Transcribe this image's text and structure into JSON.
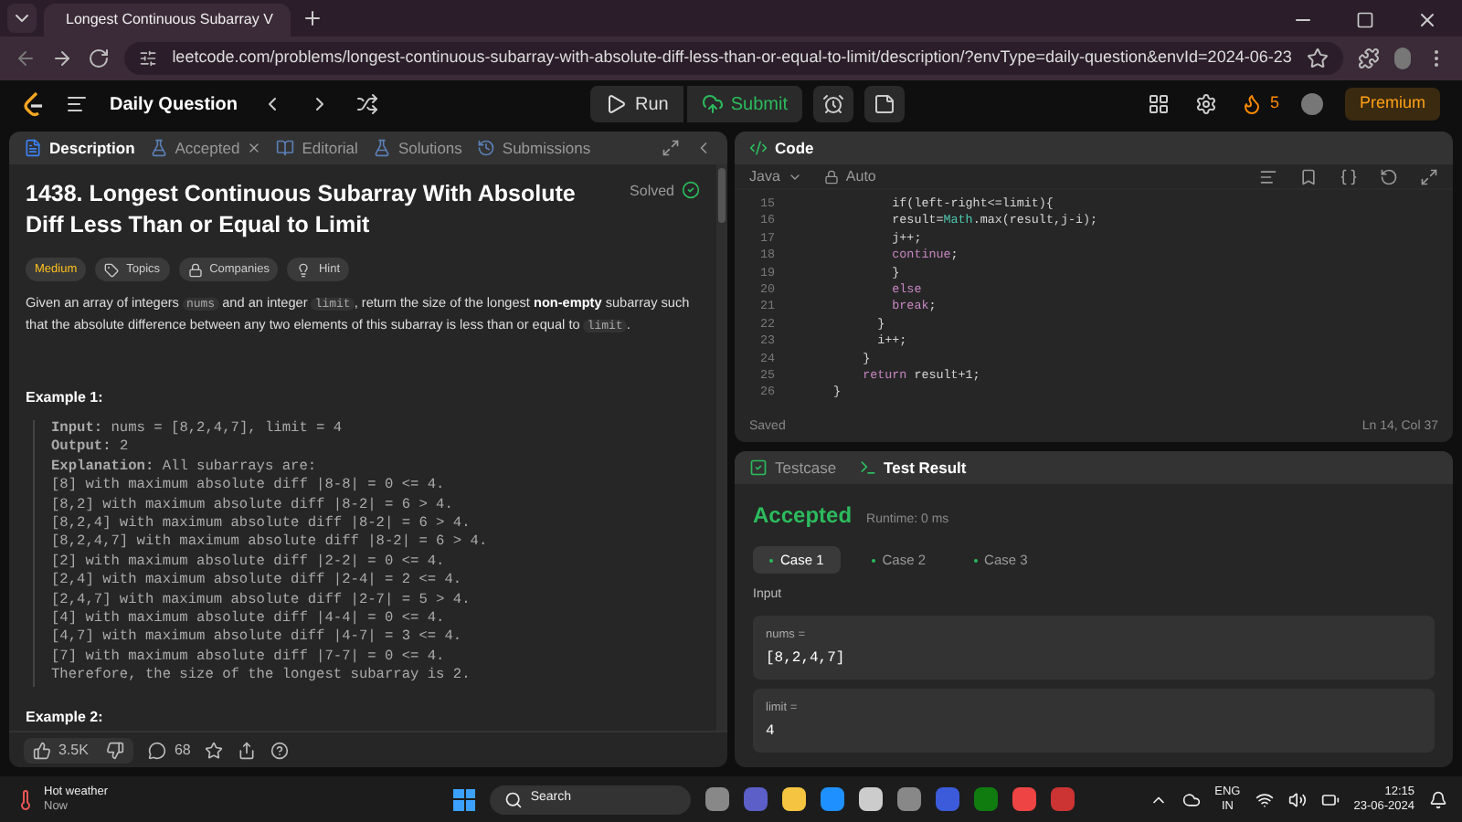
{
  "browser": {
    "tab_title": "Longest Continuous Subarray V",
    "url": "leetcode.com/problems/longest-continuous-subarray-with-absolute-diff-less-than-or-equal-to-limit/description/?envType=daily-question&envId=2024-06-23"
  },
  "nav": {
    "title": "Daily Question",
    "run": "Run",
    "submit": "Submit",
    "streak": "5",
    "premium": "Premium"
  },
  "left_tabs": [
    {
      "label": "Description",
      "selected": true
    },
    {
      "label": "Accepted",
      "selected": false,
      "closable": true
    },
    {
      "label": "Editorial",
      "selected": false
    },
    {
      "label": "Solutions",
      "selected": false
    },
    {
      "label": "Submissions",
      "selected": false
    }
  ],
  "problem": {
    "title": "1438. Longest Continuous Subarray With Absolute Diff Less Than or Equal to Limit",
    "status": "Solved",
    "tags": [
      {
        "label": "Medium",
        "kind": "difficulty"
      },
      {
        "label": "Topics",
        "kind": "topics"
      },
      {
        "label": "Companies",
        "kind": "companies"
      },
      {
        "label": "Hint",
        "kind": "hint"
      }
    ],
    "description": [
      {
        "text": "Given an array of integers ",
        "kind": "plain"
      },
      {
        "text": "nums",
        "kind": "code"
      },
      {
        "text": " and an integer ",
        "kind": "plain"
      },
      {
        "text": "limit",
        "kind": "code"
      },
      {
        "text": ", return the size of the longest ",
        "kind": "plain"
      },
      {
        "text": "non-empty",
        "kind": "bold"
      },
      {
        "text": " subarray such that the absolute difference between any two elements of this subarray is less than or equal to ",
        "kind": "plain"
      },
      {
        "text": "limit",
        "kind": "code"
      },
      {
        "text": ".",
        "kind": "plain"
      }
    ],
    "example_1_heading": "Example 1:",
    "example_1": [
      "**Input:** nums = [8,2,4,7], limit = 4",
      "**Output:** 2",
      "**Explanation:** All subarrays are:",
      "[8] with maximum absolute diff |8-8| = 0 <= 4.",
      "[8,2] with maximum absolute diff |8-2| = 6 > 4.",
      "[8,2,4] with maximum absolute diff |8-2| = 6 > 4.",
      "[8,2,4,7] with maximum absolute diff |8-2| = 6 > 4.",
      "[2] with maximum absolute diff |2-2| = 0 <= 4.",
      "[2,4] with maximum absolute diff |2-4| = 2 <= 4.",
      "[2,4,7] with maximum absolute diff |2-7| = 5 > 4.",
      "[4] with maximum absolute diff |4-4| = 0 <= 4.",
      "[4,7] with maximum absolute diff |4-7| = 3 <= 4.",
      "[7] with maximum absolute diff |7-7| = 0 <= 4.",
      "Therefore, the size of the longest subarray is 2."
    ],
    "example_2_heading": "Example 2:"
  },
  "footer": {
    "likes": "3.5K",
    "comments": "68"
  },
  "code": {
    "title": "Code",
    "language": "Java",
    "mode": "Auto",
    "lines": [
      {
        "number": "15",
        "tokens": [
          {
            "text": "            if(left-right<=limit){",
            "kind": "plain"
          }
        ]
      },
      {
        "number": "16",
        "tokens": [
          {
            "text": "            result=",
            "kind": "plain"
          },
          {
            "text": "Math",
            "kind": "class"
          },
          {
            "text": ".max(result,j-i);",
            "kind": "plain"
          }
        ]
      },
      {
        "number": "17",
        "tokens": [
          {
            "text": "            j++;",
            "kind": "plain"
          }
        ]
      },
      {
        "number": "18",
        "tokens": [
          {
            "text": "            continue",
            "kind": "keyword"
          },
          {
            "text": ";",
            "kind": "plain"
          }
        ]
      },
      {
        "number": "19",
        "tokens": [
          {
            "text": "            }",
            "kind": "plain"
          }
        ]
      },
      {
        "number": "20",
        "tokens": [
          {
            "text": "            else",
            "kind": "keyword"
          }
        ]
      },
      {
        "number": "21",
        "tokens": [
          {
            "text": "            break",
            "kind": "keyword"
          },
          {
            "text": ";",
            "kind": "plain"
          }
        ]
      },
      {
        "number": "22",
        "tokens": [
          {
            "text": "          }",
            "kind": "plain"
          }
        ]
      },
      {
        "number": "23",
        "tokens": [
          {
            "text": "          i++;",
            "kind": "plain"
          }
        ]
      },
      {
        "number": "24",
        "tokens": [
          {
            "text": "        }",
            "kind": "plain"
          }
        ]
      },
      {
        "number": "25",
        "tokens": [
          {
            "text": "        return",
            "kind": "keyword"
          },
          {
            "text": " result+1;",
            "kind": "plain"
          }
        ]
      },
      {
        "number": "26",
        "tokens": [
          {
            "text": "    }",
            "kind": "plain"
          }
        ]
      }
    ],
    "status": "Saved",
    "cursor": "Ln 14, Col 37"
  },
  "test_tabs": [
    {
      "label": "Testcase",
      "selected": false
    },
    {
      "label": "Test Result",
      "selected": true
    }
  ],
  "result": {
    "verdict": "Accepted",
    "runtime": "Runtime: 0 ms",
    "cases": [
      {
        "label": "Case 1",
        "selected": true
      },
      {
        "label": "Case 2",
        "selected": false
      },
      {
        "label": "Case 3",
        "selected": false
      }
    ],
    "input_heading": "Input",
    "inputs": [
      {
        "name": "nums =",
        "value": "[8,2,4,7]"
      },
      {
        "name": "limit =",
        "value": "4"
      }
    ]
  },
  "taskbar": {
    "weather": "Hot weather",
    "weather_sub": "Now",
    "search": "Search",
    "lang": "ENG",
    "region": "IN",
    "time": "12:15",
    "date": "23-06-2024"
  }
}
